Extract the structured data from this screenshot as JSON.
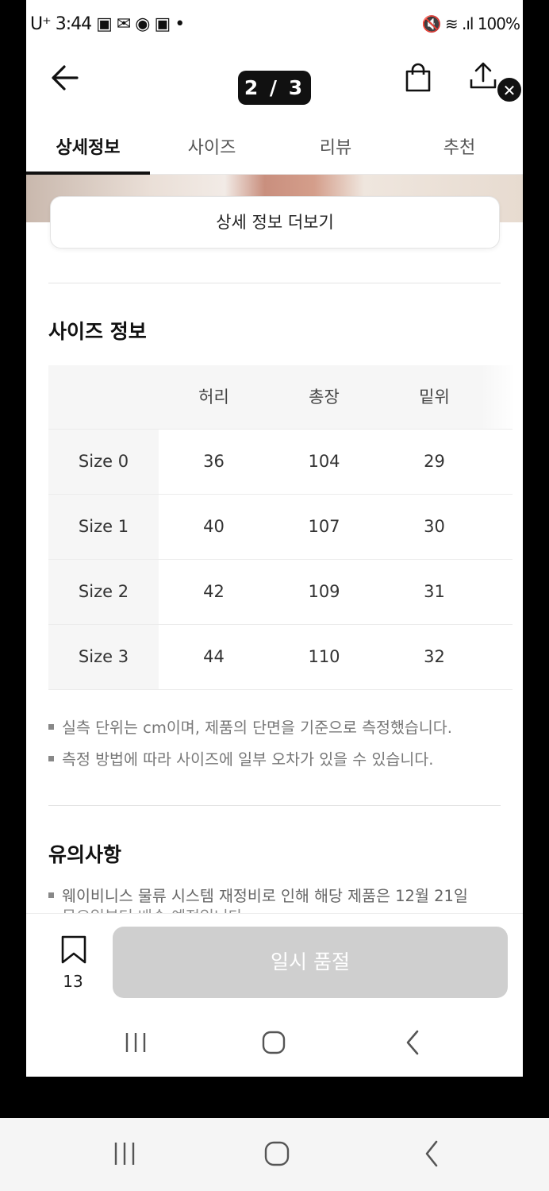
{
  "status_bar": {
    "left": "U⁺ 3:44 ▣ ✉ ◉ ▣ •",
    "right": "🔇 ≋ .ıl 100%"
  },
  "header": {
    "pager": "2 / 3"
  },
  "tabs": [
    {
      "label": "상세정보",
      "active": true
    },
    {
      "label": "사이즈",
      "active": false
    },
    {
      "label": "리뷰",
      "active": false
    },
    {
      "label": "추천",
      "active": false
    }
  ],
  "more_button": "상세 정보 더보기",
  "size_section": {
    "title": "사이즈 정보",
    "columns": [
      "",
      "허리",
      "총장",
      "밑위"
    ],
    "rows": [
      [
        "Size 0",
        "36",
        "104",
        "29"
      ],
      [
        "Size 1",
        "40",
        "107",
        "30"
      ],
      [
        "Size 2",
        "42",
        "109",
        "31"
      ],
      [
        "Size 3",
        "44",
        "110",
        "32"
      ]
    ],
    "notes": [
      "실측 단위는 cm이며, 제품의 단면을 기준으로 측정했습니다.",
      "측정 방법에 따라 사이즈에 일부 오차가 있을 수 있습니다."
    ]
  },
  "caution_section": {
    "title": "유의사항",
    "notes": [
      "웨이비니스 물류 시스템 재정비로 인해 해당 제품은 12월 21일",
      "목요일부터 배송 예정입니다"
    ]
  },
  "bottom_bar": {
    "bookmark_count": "13",
    "soldout_label": "일시 품절"
  },
  "colors": {
    "accent": "#111111",
    "disabled_button": "#cfcfcf",
    "table_header_bg": "#f6f6f6"
  }
}
